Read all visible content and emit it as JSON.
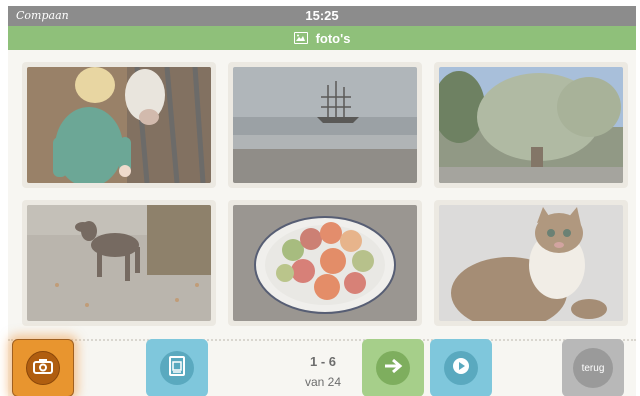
{
  "status_bar": {
    "brand": "Compaan",
    "time": "15:25"
  },
  "header": {
    "title": "foto's",
    "icon": "image-icon"
  },
  "photos": [
    {
      "name": "photo-child-with-calf",
      "subject": "child-cow"
    },
    {
      "name": "photo-sailing-ship",
      "subject": "ship"
    },
    {
      "name": "photo-olive-tree",
      "subject": "tree"
    },
    {
      "name": "photo-dog",
      "subject": "dog"
    },
    {
      "name": "photo-apples-bowl",
      "subject": "apples"
    },
    {
      "name": "photo-kitten",
      "subject": "kitten"
    }
  ],
  "pager": {
    "range": "1 - 6",
    "total": "van 24"
  },
  "buttons": {
    "camera": {
      "icon": "camera-icon"
    },
    "album": {
      "icon": "album-icon"
    },
    "next": {
      "icon": "arrow-right-icon"
    },
    "play": {
      "icon": "play-icon"
    },
    "back": {
      "label": "terug"
    }
  },
  "colors": {
    "status_bar": "#8c8c8c",
    "title_bar": "#8fc07a",
    "camera_button": "#e8952f",
    "blue_button": "#7fc7dc",
    "green_button": "#a6cf8a",
    "back_button": "#b8b8b8"
  }
}
